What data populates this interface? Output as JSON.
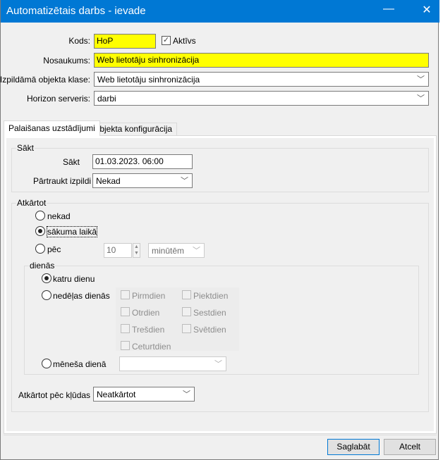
{
  "window": {
    "title": "Automatizētais darbs - ievade",
    "minimize": "—",
    "close": "✕"
  },
  "form": {
    "kods_label": "Kods:",
    "kods_value": "HoP",
    "aktivs_label": "Aktīvs",
    "aktivs_checked": true,
    "nosaukums_label": "Nosaukums:",
    "nosaukums_value": "Web lietotāju sinhronizācija",
    "klase_label": "Izpildāmā objekta klase:",
    "klase_value": "Web lietotāju sinhronizācija",
    "serveris_label": "Horizon serveris:",
    "serveris_value": "darbi"
  },
  "tabs": [
    {
      "label": "Palaišanas uzstādījumi",
      "active": true
    },
    {
      "label": "Objekta konfigurācija",
      "active": false
    }
  ],
  "start": {
    "group_label": "Sākt",
    "sakt_label": "Sākt",
    "sakt_value": "01.03.2023. 06:00",
    "partraukt_label": "Pārtraukt izpildi",
    "partraukt_value": "Nekad"
  },
  "repeat": {
    "group_label": "Atkārtot",
    "options": [
      {
        "label": "nekad",
        "selected": false
      },
      {
        "label": "sākuma laikā",
        "selected": true
      },
      {
        "label": "pēc",
        "selected": false
      }
    ],
    "interval_value": "10",
    "interval_unit": "minūtēm",
    "days": {
      "group_label": "dienās",
      "options": [
        {
          "label": "katru dienu",
          "selected": true
        },
        {
          "label": "nedēļas dienās",
          "selected": false
        },
        {
          "label": "mēneša dienā",
          "selected": false
        }
      ],
      "weekdays": [
        "Pirmdien",
        "Otrdien",
        "Trešdien",
        "Ceturtdien",
        "Piektdien",
        "Sestdien",
        "Svētdien"
      ],
      "month_day_value": ""
    },
    "error_label": "Atkārtot pēc kļūdas",
    "error_value": "Neatkārtot"
  },
  "footer": {
    "save": "Saglabāt",
    "cancel": "Atcelt"
  },
  "icons": {
    "chevron": "chevron-down-icon",
    "check": "checkmark-icon"
  }
}
